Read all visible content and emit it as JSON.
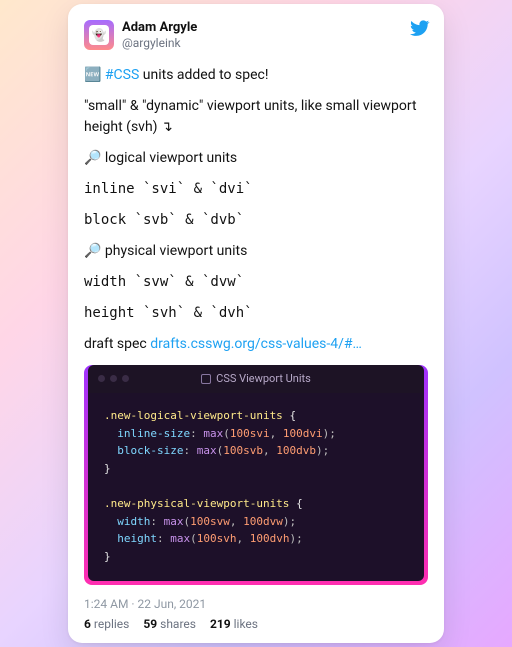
{
  "user": {
    "display_name": "Adam Argyle",
    "handle": "@argyleink",
    "avatar_emoji": "👻"
  },
  "tweet": {
    "lead_emoji": "🆕",
    "hashtag": "#CSS",
    "headline_tail": " units added to spec!",
    "p2": "\"small\" & \"dynamic\" viewport units, like small viewport height (svh) ↴",
    "p3_lead": "🔎 logical viewport units",
    "p3_a": "inline `svi` & `dvi`",
    "p3_b": "block `svb` & `dvb`",
    "p4_lead": "🔎 physical viewport units",
    "p4_a": "width `svw` & `dvw`",
    "p4_b": "height `svh` & `dvh`",
    "spec_label": "draft spec ",
    "spec_link": "drafts.csswg.org/css-values-4/#…"
  },
  "code": {
    "title": "CSS Viewport Units",
    "sel1": ".new-logical-viewport-units",
    "p1a_k": "inline-size",
    "p1a_v1": "100svi",
    "p1a_v2": "100dvi",
    "p1b_k": "block-size",
    "p1b_v1": "100svb",
    "p1b_v2": "100dvb",
    "sel2": ".new-physical-viewport-units",
    "p2a_k": "width",
    "p2a_v1": "100svw",
    "p2a_v2": "100dvw",
    "p2b_k": "height",
    "p2b_v1": "100svh",
    "p2b_v2": "100dvh",
    "fn": "max"
  },
  "meta": {
    "time": "1:24 AM",
    "sep": " · ",
    "date": "22 Jun, 2021"
  },
  "stats": {
    "replies_n": "6",
    "replies_l": "replies",
    "shares_n": "59",
    "shares_l": "shares",
    "likes_n": "219",
    "likes_l": "likes"
  }
}
